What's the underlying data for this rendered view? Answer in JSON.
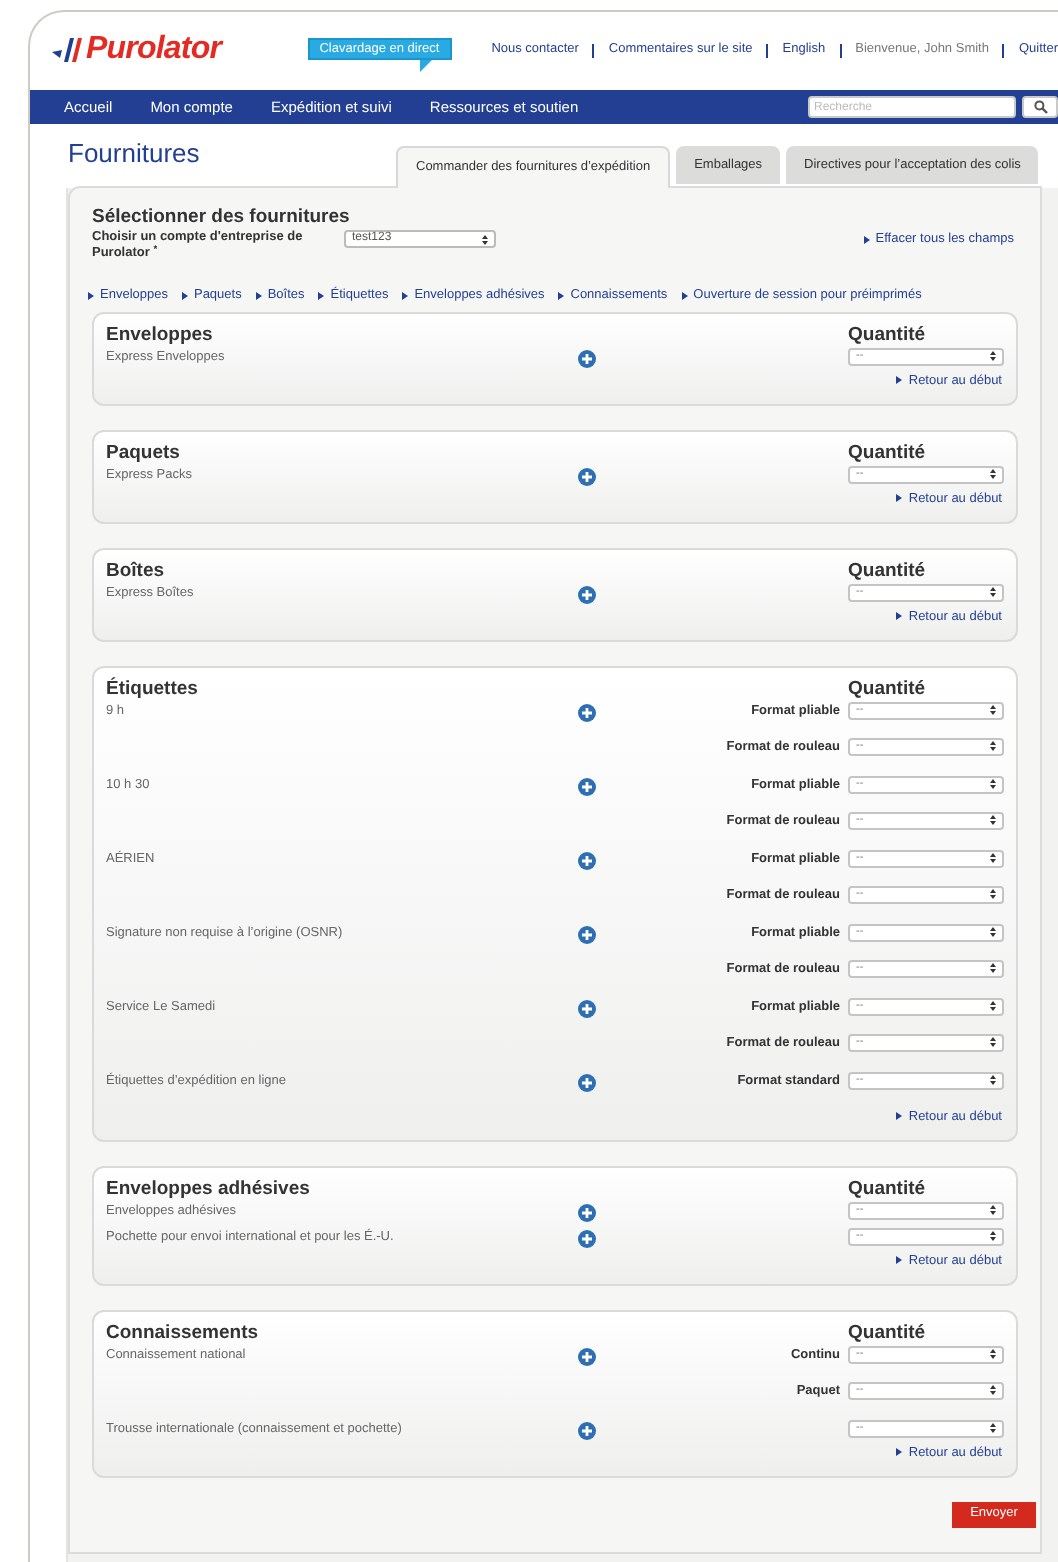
{
  "header": {
    "logo": "Purolator",
    "chat_button": "Clavardage en direct",
    "links": [
      {
        "label": "Nous contacter",
        "kind": "link"
      },
      {
        "label": "Commentaires sur le site",
        "kind": "link"
      },
      {
        "label": "English",
        "kind": "link"
      },
      {
        "label": "Bienvenue, John Smith",
        "kind": "text"
      },
      {
        "label": "Quitter",
        "kind": "link"
      }
    ]
  },
  "nav": {
    "items": [
      "Accueil",
      "Mon compte",
      "Expédition et suivi",
      "Ressources et soutien"
    ],
    "search": {
      "placeholder": "Recherche"
    }
  },
  "page_title": "Fournitures",
  "tabs": [
    {
      "label": "Commander des fournitures d’expédition",
      "selected": true
    },
    {
      "label": "Emballages",
      "selected": false
    },
    {
      "label": "Directives pour l’acceptation des colis",
      "selected": false
    }
  ],
  "selection": {
    "title": "Sélectionner des fournitures",
    "account_label": "Choisir un compte d'entreprise de Purolator $^{*}$",
    "account_value": "test123",
    "clear_link": "Effacer tous les champs"
  },
  "anchors": [
    "Enveloppes",
    "Paquets",
    "Boîtes",
    "Étiquettes",
    "Enveloppes adhésives",
    "Connaissements",
    "Ouverture de session pour préimprimés"
  ],
  "sections": [
    {
      "title": "Enveloppes",
      "quantity_label": "Quantité",
      "items": [
        {
          "name": "Express Enveloppes",
          "formats": [
            {
              "value": "--"
            }
          ]
        }
      ],
      "back_link": "Retour au début"
    },
    {
      "title": "Paquets",
      "quantity_label": "Quantité",
      "items": [
        {
          "name": "Express Packs",
          "formats": [
            {
              "value": "--"
            }
          ]
        }
      ],
      "back_link": "Retour au début"
    },
    {
      "title": "Boîtes",
      "quantity_label": "Quantité",
      "items": [
        {
          "name": "Express Boîtes",
          "formats": [
            {
              "value": "--"
            }
          ]
        }
      ],
      "back_link": "Retour au début"
    },
    {
      "title": "Étiquettes",
      "quantity_label": "Quantité",
      "items": [
        {
          "name": "9 h",
          "formats": [
            {
              "label": "Format pliable",
              "value": "--"
            },
            {
              "label": "Format de rouleau",
              "value": "--"
            }
          ]
        },
        {
          "name": "10 h 30",
          "formats": [
            {
              "label": "Format pliable",
              "value": "--"
            },
            {
              "label": "Format de rouleau",
              "value": "--"
            }
          ]
        },
        {
          "name": "AÉRIEN",
          "formats": [
            {
              "label": "Format pliable",
              "value": "--"
            },
            {
              "label": "Format de rouleau",
              "value": "--"
            }
          ]
        },
        {
          "name": "Signature non requise à l’origine (OSNR)",
          "formats": [
            {
              "label": "Format pliable",
              "value": "--"
            },
            {
              "label": "Format de rouleau",
              "value": "--"
            }
          ]
        },
        {
          "name": "Service Le Samedi",
          "formats": [
            {
              "label": "Format pliable",
              "value": "--"
            },
            {
              "label": "Format de rouleau",
              "value": "--"
            }
          ]
        },
        {
          "name": "Étiquettes d’expédition en ligne",
          "formats": [
            {
              "label": "Format standard",
              "value": "--"
            }
          ]
        }
      ],
      "back_link": "Retour au début"
    },
    {
      "title": "Enveloppes adhésives",
      "quantity_label": "Quantité",
      "items": [
        {
          "name": "Enveloppes adhésives",
          "formats": [
            {
              "value": "--"
            }
          ]
        },
        {
          "name": "Pochette pour envoi international et pour les É.-U.",
          "formats": [
            {
              "value": "--"
            }
          ]
        }
      ],
      "back_link": "Retour au début"
    },
    {
      "title": "Connaissements",
      "quantity_label": "Quantité",
      "items": [
        {
          "name": "Connaissement national",
          "formats": [
            {
              "label": "Continu",
              "value": "--"
            },
            {
              "label": "Paquet",
              "value": "--"
            }
          ]
        },
        {
          "name": "Trousse internationale (connaissement et pochette)",
          "formats": [
            {
              "value": "--"
            }
          ]
        }
      ],
      "back_link": "Retour au début"
    }
  ],
  "submit": "Envoyer"
}
